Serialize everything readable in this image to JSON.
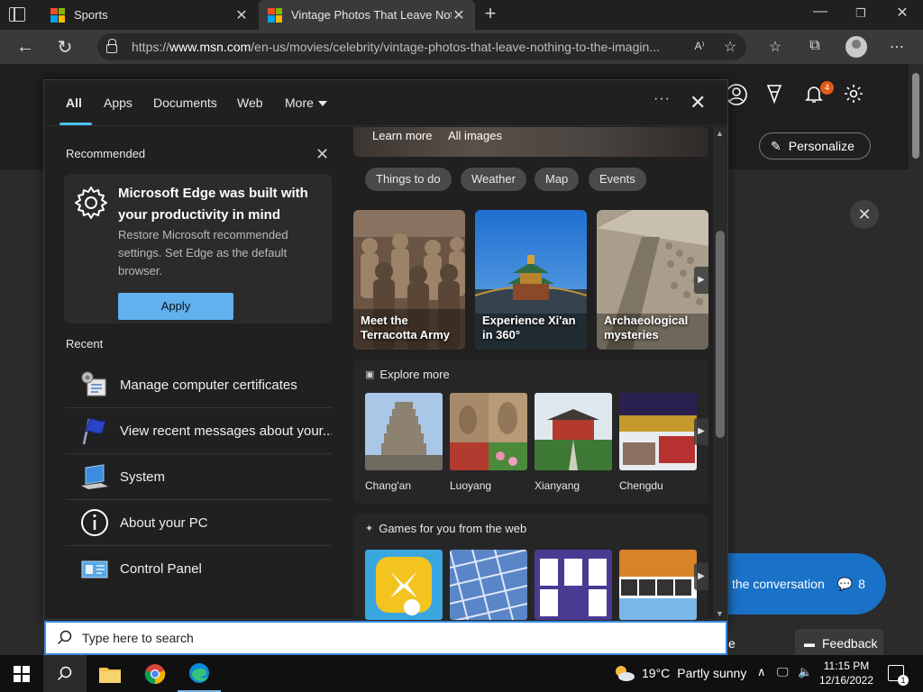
{
  "browser": {
    "tabs": [
      {
        "title": "Sports"
      },
      {
        "title": "Vintage Photos That Leave Nothing to the Imagination"
      }
    ],
    "url_prefix": "https://",
    "url_host": "www.msn.com",
    "url_path": "/en-us/movies/celebrity/vintage-photos-that-leave-nothing-to-the-imagin..."
  },
  "msn": {
    "notification_count": "4",
    "personalize_label": "Personalize",
    "conversation_label": "the conversation",
    "conversation_count": "8",
    "feedback_label": "Feedback",
    "snippet": "e"
  },
  "search_panel": {
    "tabs": [
      "All",
      "Apps",
      "Documents",
      "Web",
      "More"
    ],
    "recommended": {
      "title": "Recommended",
      "heading": "Microsoft Edge was built with your productivity in mind",
      "body": "Restore Microsoft recommended settings. Set Edge as the default browser.",
      "button": "Apply"
    },
    "recent": {
      "title": "Recent",
      "items": [
        {
          "label": "Manage computer certificates",
          "icon": "certificate-icon"
        },
        {
          "label": "View recent messages about your...",
          "icon": "flag-icon"
        },
        {
          "label": "System",
          "icon": "laptop-icon"
        },
        {
          "label": "About your PC",
          "icon": "info-icon"
        },
        {
          "label": "Control Panel",
          "icon": "control-panel-icon"
        }
      ]
    },
    "image_strip": {
      "learn_more": "Learn more",
      "all_images": "All images"
    },
    "chips": [
      "Things to do",
      "Weather",
      "Map",
      "Events"
    ],
    "cards": [
      {
        "label": "Meet the Terracotta Army"
      },
      {
        "label": "Experience Xi'an in 360°"
      },
      {
        "label": "Archaeological mysteries"
      }
    ],
    "explore": {
      "title": "Explore more",
      "places": [
        "Chang'an",
        "Luoyang",
        "Xianyang",
        "Chengdu"
      ]
    },
    "games": {
      "title": "Games for you from the web"
    },
    "search_placeholder": "Type here to search"
  },
  "taskbar": {
    "temperature": "19°C",
    "weather": "Partly sunny",
    "time": "11:15 PM",
    "date": "12/16/2022",
    "notification_count": "1"
  }
}
